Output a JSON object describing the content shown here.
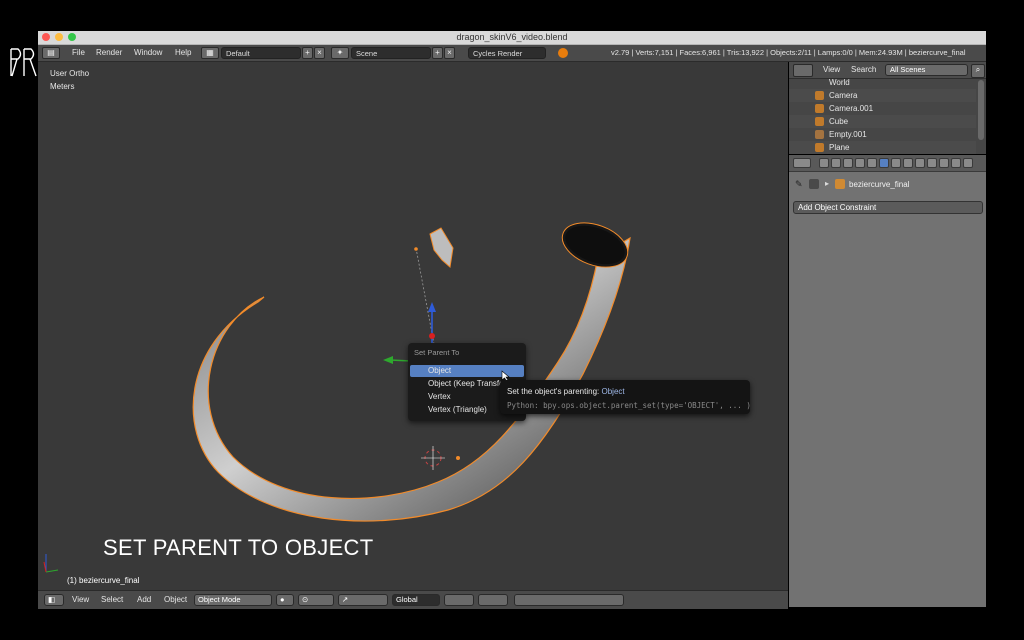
{
  "window": {
    "title": "dragon_skinV6_video.blend"
  },
  "menubar": {
    "menus": [
      "File",
      "Render",
      "Window",
      "Help"
    ],
    "layout": "Default",
    "scene": "Scene",
    "engine": "Cycles Render",
    "status": "v2.79 | Verts:7,151 | Faces:6,961 | Tris:13,922 | Objects:2/11 | Lamps:0/0 | Mem:24.93M | beziercurve_final"
  },
  "viewport": {
    "view_name": "User Ortho",
    "units": "Meters",
    "active_object": "(1) beziercurve_final",
    "caption": "SET PARENT TO OBJECT"
  },
  "popup": {
    "title": "Set Parent To",
    "items": [
      "Object",
      "Object (Keep Transform)",
      "Vertex",
      "Vertex (Triangle)"
    ]
  },
  "tooltip": {
    "label": "Set the object's parenting:",
    "operator": "Object",
    "python": "Python: bpy.ops.object.parent_set(type='OBJECT', ... )"
  },
  "bottombar": {
    "menus": [
      "View",
      "Select",
      "Add",
      "Object"
    ],
    "mode": "Object Mode",
    "orientation": "Global"
  },
  "outliner": {
    "header": {
      "view": "View",
      "search": "Search",
      "filter": "All Scenes"
    },
    "items": [
      "World",
      "Camera",
      "Camera.001",
      "Cube",
      "Empty.001",
      "Plane"
    ]
  },
  "properties": {
    "object_name": "beziercurve_final",
    "add_constraint": "Add Object Constraint"
  },
  "colors": {
    "accent": "#5680c2",
    "outline": "#f28b2a"
  }
}
